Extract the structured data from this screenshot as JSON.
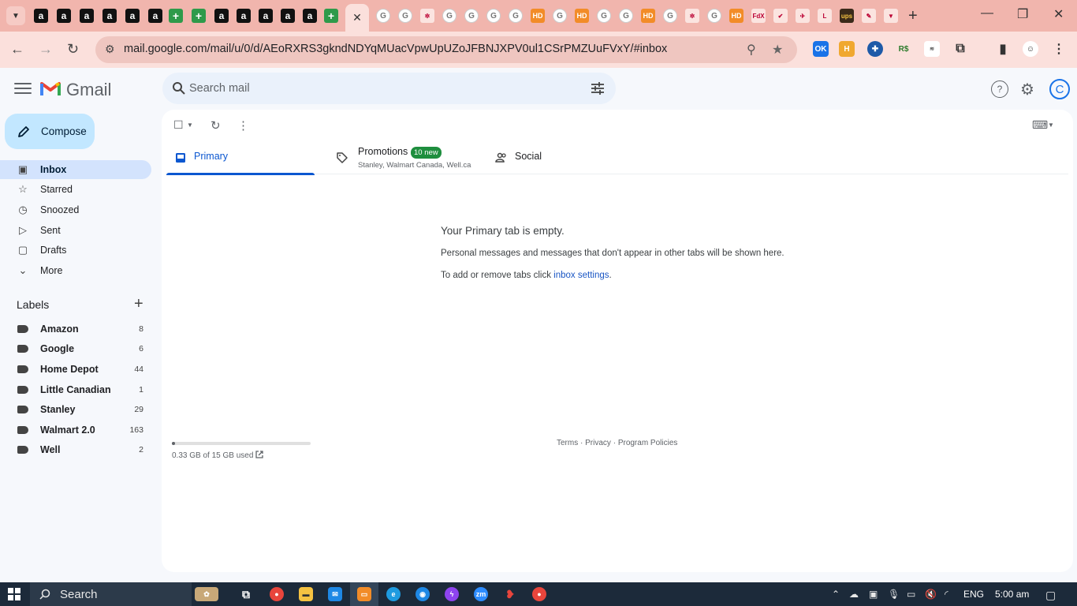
{
  "browser": {
    "url": "mail.google.com/mail/u/0/d/AEoRXRS3gkndNDYqMUacVpwUpUZoJFBNJXPV0ul1CSrPMZUuFVxY/#inbox",
    "close_glyph": "✕",
    "new_tab_glyph": "+",
    "extension_badge": "OK"
  },
  "gmail": {
    "logo_text": "Gmail",
    "search_placeholder": "Search mail",
    "account_initial": "C",
    "compose_label": "Compose"
  },
  "nav": [
    {
      "label": "Inbox",
      "icon": "inbox-icon",
      "active": true
    },
    {
      "label": "Starred",
      "icon": "star-icon"
    },
    {
      "label": "Snoozed",
      "icon": "clock-icon"
    },
    {
      "label": "Sent",
      "icon": "send-icon"
    },
    {
      "label": "Drafts",
      "icon": "draft-icon"
    },
    {
      "label": "More",
      "icon": "chevron-down-icon"
    }
  ],
  "labels": {
    "title": "Labels",
    "items": [
      {
        "name": "Amazon",
        "count": "8"
      },
      {
        "name": "Google",
        "count": "6"
      },
      {
        "name": "Home Depot",
        "count": "44"
      },
      {
        "name": "Little Canadian",
        "count": "1"
      },
      {
        "name": "Stanley",
        "count": "29"
      },
      {
        "name": "Walmart 2.0",
        "count": "163"
      },
      {
        "name": "Well",
        "count": "2"
      }
    ]
  },
  "tabs": {
    "primary": "Primary",
    "promotions": "Promotions",
    "promotions_badge": "10 new",
    "promotions_senders": "Stanley, Walmart Canada, Well.ca",
    "social": "Social"
  },
  "empty": {
    "title": "Your Primary tab is empty.",
    "description": "Personal messages and messages that don't appear in other tabs will be shown here.",
    "add_prefix": "To add or remove tabs click ",
    "add_link": "inbox settings",
    "add_suffix": "."
  },
  "storage": {
    "text": "0.33 GB of 15 GB used",
    "fraction": 0.022
  },
  "footer": {
    "terms": "Terms",
    "privacy": "Privacy",
    "policies": "Program Policies",
    "separator": " · "
  },
  "taskbar": {
    "search_label": "Search",
    "language": "ENG",
    "time": "5:00 am"
  }
}
